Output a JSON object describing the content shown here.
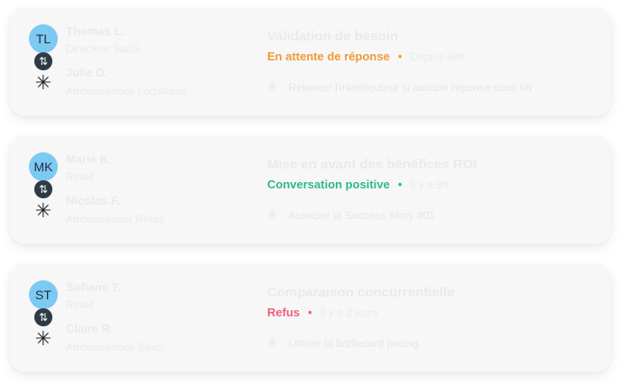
{
  "cards": [
    {
      "initials": "TL",
      "person1": {
        "name": "Thomas L.",
        "role": "Directeur SaaS"
      },
      "person2": {
        "name": "Julie D.",
        "role": "Ambassadrice Logistique"
      },
      "title": "Validation de besoin",
      "status": "En attente de réponse",
      "status_color": "#f29a38",
      "time": "Depuis 48h",
      "action": "Relancer l'interlocuteur si aucune réponse sous 6h"
    },
    {
      "initials": "MK",
      "person1": {
        "name": "Marie K.",
        "role": "Retail"
      },
      "person2": {
        "name": "Nicolas F.",
        "role": "Ambassadeur Retail"
      },
      "title": "Mise en avant des bénéfices ROI",
      "status": "Conversation positive",
      "status_color": "#2fb88d",
      "time": "Il y a 3h",
      "action": "Associer la Success Story #01"
    },
    {
      "initials": "ST",
      "person1": {
        "name": "Sofiane T.",
        "role": "Retail"
      },
      "person2": {
        "name": "Claire R.",
        "role": "Ambassadrice SaaS"
      },
      "title": "Comparaison concurrentielle",
      "status": "Refus",
      "status_color": "#f0627a",
      "time": "Il y a 2 jours",
      "action": "Utiliser la battlecard pricing"
    }
  ],
  "icons": {
    "swap": "swap-arrows-icon",
    "snow": "snowflake-icon",
    "action": "sparkle-icon"
  }
}
